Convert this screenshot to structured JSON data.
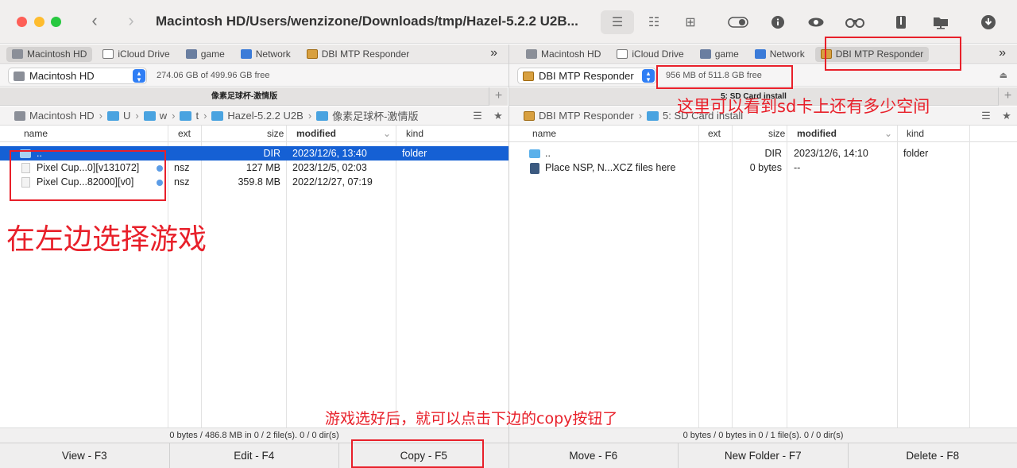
{
  "window": {
    "title": "Macintosh HD/Users/wenzizone/Downloads/tmp/Hazel-5.2.2 U2B..."
  },
  "toolbar_icons": [
    "list-view-icon",
    "detail-view-icon",
    "grid-view-icon",
    "toggle-icon",
    "info-icon",
    "eye-icon",
    "binoculars-icon",
    "archive-icon",
    "network-drive-icon",
    "download-icon"
  ],
  "favorites": {
    "left": [
      {
        "label": "Macintosh HD",
        "icon": "hard-drive-icon",
        "selected": true
      },
      {
        "label": "iCloud Drive",
        "icon": "cloud-icon"
      },
      {
        "label": "game",
        "icon": "drive-icon"
      },
      {
        "label": "Network",
        "icon": "network-icon"
      },
      {
        "label": "DBI MTP Responder",
        "icon": "mtp-device-icon"
      }
    ],
    "right": [
      {
        "label": "Macintosh HD",
        "icon": "hard-drive-icon"
      },
      {
        "label": "iCloud Drive",
        "icon": "cloud-icon"
      },
      {
        "label": "game",
        "icon": "drive-icon"
      },
      {
        "label": "Network",
        "icon": "network-icon"
      },
      {
        "label": "DBI MTP Responder",
        "icon": "mtp-device-icon",
        "selected": true
      }
    ],
    "more": "»"
  },
  "left": {
    "volume": "Macintosh HD",
    "free": "274.06 GB of 499.96 GB free",
    "path_title": "像素足球杯-激情版",
    "breadcrumb": [
      "Macintosh HD",
      "U",
      "w",
      "t",
      "Hazel-5.2.2 U2B",
      "像素足球杯-激情版"
    ],
    "columns": {
      "name": "name",
      "ext": "ext",
      "size": "size",
      "modified": "modified",
      "kind": "kind"
    },
    "rows": [
      {
        "name": "..",
        "ext": "",
        "size": "DIR",
        "modified": "2023/12/6, 13:40",
        "kind": "folder"
      },
      {
        "name": "Pixel Cup...0][v131072]",
        "ext": "nsz",
        "size": "127 MB",
        "modified": "2023/12/5, 02:03",
        "kind": ""
      },
      {
        "name": "Pixel Cup...82000][v0]",
        "ext": "nsz",
        "size": "359.8 MB",
        "modified": "2022/12/27, 07:19",
        "kind": ""
      }
    ],
    "status": "0 bytes / 486.8 MB in 0 / 2 file(s). 0 / 0 dir(s)"
  },
  "right": {
    "volume": "DBI MTP Responder",
    "free": "956 MB of 511.8 GB free",
    "path_title": "5: SD Card install",
    "breadcrumb": [
      "DBI MTP Responder",
      "5: SD Card install"
    ],
    "columns": {
      "name": "name",
      "ext": "ext",
      "size": "size",
      "modified": "modified",
      "kind": "kind"
    },
    "rows": [
      {
        "name": "..",
        "ext": "",
        "size": "DIR",
        "modified": "2023/12/6, 14:10",
        "kind": "folder"
      },
      {
        "name": "Place NSP, N...XCZ files here",
        "ext": "",
        "size": "0 bytes",
        "modified": "--",
        "kind": ""
      }
    ],
    "status": "0 bytes / 0 bytes in 0 / 1 file(s). 0 / 0 dir(s)"
  },
  "function_keys": [
    "View - F3",
    "Edit - F4",
    "Copy - F5",
    "Move - F6",
    "New Folder - F7",
    "Delete - F8"
  ],
  "annotations": {
    "select_game": "在左边选择游戏",
    "sd_space": "这里可以看到sd卡上还有多少空间",
    "copy_hint": "游戏选好后，就可以点击下边的copy按钮了"
  },
  "colors": {
    "selection": "#1560d4",
    "annotation": "#e8202a",
    "accent": "#2f7ef5"
  }
}
